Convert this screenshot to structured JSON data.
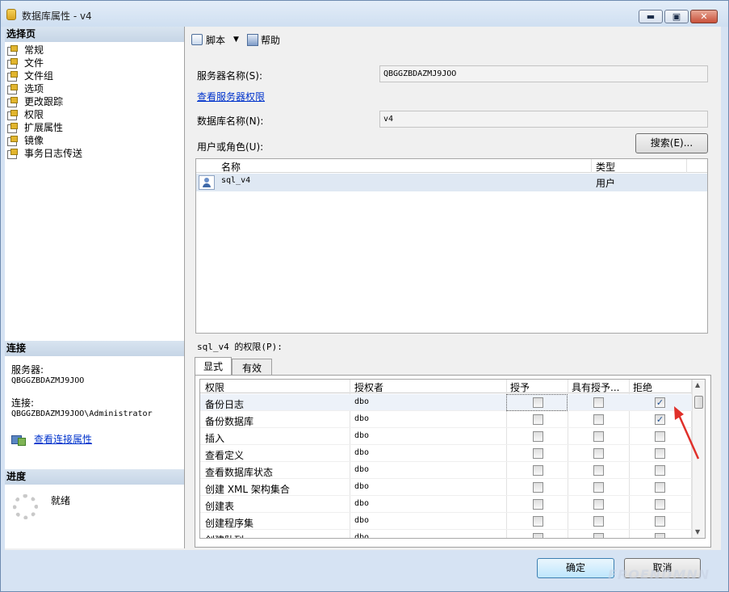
{
  "window": {
    "title": "数据库属性 - v4",
    "minimize": "▬",
    "maximize": "▣",
    "close": "✕"
  },
  "left": {
    "select_page_header": "选择页",
    "pages": [
      "常规",
      "文件",
      "文件组",
      "选项",
      "更改跟踪",
      "权限",
      "扩展属性",
      "镜像",
      "事务日志传送"
    ],
    "connection_header": "连接",
    "server_label": "服务器:",
    "server_value": "QBGGZBDAZMJ9JOO",
    "connection_label": "连接:",
    "connection_value": "QBGGZBDAZMJ9JOO\\Administrator",
    "view_connection_link": "查看连接属性",
    "progress_header": "进度",
    "progress_status": "就绪"
  },
  "toolbar": {
    "script_label": "脚本",
    "help_label": "帮助"
  },
  "form": {
    "server_name_label": "服务器名称(S):",
    "server_name_value": "QBGGZBDAZMJ9JOO",
    "view_server_permissions_link": "查看服务器权限",
    "database_name_label": "数据库名称(N):",
    "database_name_value": "v4",
    "users_roles_label": "用户或角色(U):",
    "search_button": "搜索(E)..."
  },
  "users_grid": {
    "columns": [
      "名称",
      "类型"
    ],
    "rows": [
      {
        "name": "sql_v4",
        "type": "用户"
      }
    ]
  },
  "permissions": {
    "label": "sql_v4 的权限(P):",
    "tabs": [
      "显式",
      "有效"
    ],
    "columns": [
      "权限",
      "授权者",
      "授予",
      "具有授予...",
      "拒绝"
    ],
    "rows": [
      {
        "permission": "备份日志",
        "grantor": "dbo",
        "grant": false,
        "with_grant": false,
        "deny": true
      },
      {
        "permission": "备份数据库",
        "grantor": "dbo",
        "grant": false,
        "with_grant": false,
        "deny": true
      },
      {
        "permission": "插入",
        "grantor": "dbo",
        "grant": false,
        "with_grant": false,
        "deny": false
      },
      {
        "permission": "查看定义",
        "grantor": "dbo",
        "grant": false,
        "with_grant": false,
        "deny": false
      },
      {
        "permission": "查看数据库状态",
        "grantor": "dbo",
        "grant": false,
        "with_grant": false,
        "deny": false
      },
      {
        "permission": "创建 XML 架构集合",
        "grantor": "dbo",
        "grant": false,
        "with_grant": false,
        "deny": false
      },
      {
        "permission": "创建表",
        "grantor": "dbo",
        "grant": false,
        "with_grant": false,
        "deny": false
      },
      {
        "permission": "创建程序集",
        "grantor": "dbo",
        "grant": false,
        "with_grant": false,
        "deny": false
      },
      {
        "permission": "创建队列",
        "grantor": "dbo",
        "grant": false,
        "with_grant": false,
        "deny": false
      }
    ]
  },
  "footer": {
    "ok_button": "确定",
    "cancel_button": "取消"
  },
  "colors": {
    "arrow": "#e0302a",
    "link": "#0033cc",
    "selected_row": "#dfe8f3"
  },
  "watermark": "FROENDMNN"
}
